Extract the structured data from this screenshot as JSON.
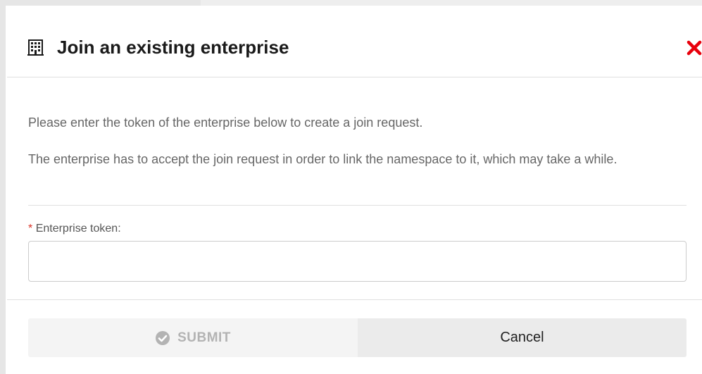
{
  "dialog": {
    "title": "Join an existing enterprise",
    "title_icon": "building-icon",
    "close_icon": "close-icon",
    "accent_close_color": "#e8000b"
  },
  "body": {
    "instruction": "Please enter the token of the enterprise below to create a join request.",
    "note": "The enterprise has to accept the join request in order to link the namespace to it, which may take a while."
  },
  "form": {
    "required_marker": "*",
    "token_label": "Enterprise token:",
    "token_value": "",
    "token_placeholder": ""
  },
  "actions": {
    "submit_label": "SUBMIT",
    "submit_icon": "check-circle-icon",
    "submit_disabled": true,
    "cancel_label": "Cancel"
  }
}
